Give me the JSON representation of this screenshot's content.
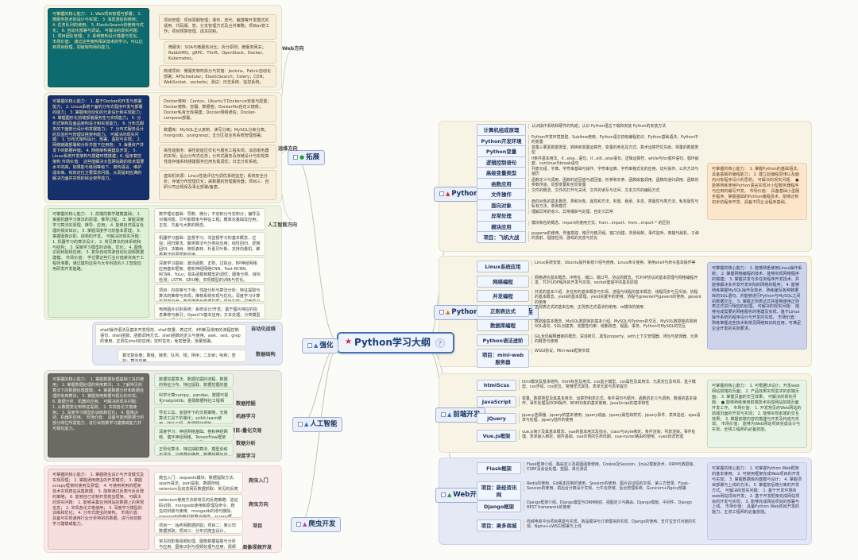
{
  "root": {
    "title": "Python学习大纲",
    "badge": "?"
  },
  "branches": {
    "tuozhan": {
      "label": "拓展"
    },
    "qianghua": {
      "label": "强化"
    },
    "ai": {
      "label": "人工智能"
    },
    "pachong": {
      "label": "爬虫开发"
    },
    "core": {
      "label": "Python核心编程"
    },
    "linux": {
      "label": "Python和Linux高级编程"
    },
    "front": {
      "label": "前端开发"
    },
    "web": {
      "label": "Web开发"
    }
  },
  "directions": {
    "web": "Web方向",
    "yunwei": "运维方向",
    "ai": "人工智能方向",
    "auto": "自动化运维",
    "datastruct": "数据结构",
    "spider": "爬虫方向",
    "project": "项目",
    "image": "图像视频开发",
    "entry": "爬虫入门",
    "ml": "机器学习",
    "quant": "项目:量化交易",
    "datacollect": "数据挖掘",
    "dataanalysis": "数据分析",
    "deeplearn": "深度学习"
  },
  "tuozhan": {
    "web": {
      "capability": "可掌握的核心能力：\n1. Web项目管理与部署；\n2. 微服务技术的设计与实现；\n3. 消息滞后的使用；\n4. 任务队列的使用；\n5. ElasticSearch的使用与优化；\n6. 自动化部署与调试。\n可解决的现实问题：\n1. 项目团队管理；\n2. 系统架构设计搭建与优化。\n市场价值：\n通过这些架构相关技术的学习，可以达到项目经理、初级架构师的能力。",
      "detail1": "项目管理：项目周期管理；瀑布、迭代、敏捷等开发模式的适用、代码版、管、分支管理方式及合并策略；项目as管工作；项目预算管理、成本控制。",
      "detail2": "微服务：SOA与微服务对比；拆分原则；微服务网关；RabbitMQ、gRPC、Thrift、OpenStack、Docker、Kubernetes。",
      "detail3": "商城项目：微服务架构拆分与实施：Jenkins、Fabric自动化部署；APScheduler；ElasticSearch；Celery；CDN；WebSocket、socketio；测试：日志系统、监控系统。"
    },
    "yunwei": {
      "capability": "可掌握的核心能力：\n1. 基于Docker的开发与部署能力；\n2. Linux系统下面的分布式程序开发与部署的能力；\n3. 掌握用自动化的元素设计和实现能力；\n4. 掌握图形化前端部署服务性与实现能力；\n5. 分布式架构及面品架构设计和实现能力；\n6. 分布式服务的下面部分设计和发展能力；\n7. 分布式服务设计的及监控与管理设搭架构能力。\n可解决的现实问题：\n1. 分布式架构设计、部署、监控与实现；\n2. 网络链路部署和分析并能下应用管；\n3. 海量资产并发下的数据存储；\n4. 网络架构搭建及开发；\n5. Linux系统开发架构与搭建环境搭建；6. 程序复控架构\n市场价值：\n这些能解决大型网站跨的技术需要水平的高，如果能与级别等级下、架构语言、维护成本高、有效定位主要需求问题，从而提到应满的解决方面并实现的综合架界能力。",
      "detail1": "Docker使用：Centos、Ubuntu下Docker-ce安装与配置；Docker镜像、容器、数据卷；Dockerfile自定义镜像；Docker私有仓库搭建；Docker网络通信；Docker-compose部署。",
      "detail2": "数据库：MySQL主从复制、读写分离；MySQL分库分表；mongodb、postgresql；五分区如业务系统管理部署。",
      "detail3": "高性能服务：高性能能区优化与服务工程实现；消息服务器的实现；后台分布式任务；分布式服务及存储设计与实现高性能存储系统搭建服务应用负载调优；日志分析系统。",
      "detail4": "虚拟机资源：Linux性能评估与调优系统监控；系统安全分析；存储分布管理优化；高数据的管理服务器；项目三：自研公司合规保及事业部署/备案。"
    },
    "ai_capability": {
      "capability": "可掌握的核心能力：\n1. 前端的数学建模基础；\n2. 掌握机器学习算法的原理、推导过程；\n3. 掌握深度学习算法的原理、推导、应用；\n4. 能够自然语言处理的相关知识；\n5. 掌握深度学习的基本原理；\n6. 掌握图像识别、视频的开发。\n可解决的现实问题：\n1. 机器学习的算法设计；\n2. 常见算法的体系统和与结构；\n3. 深度学习模型的训练、优化；\n4. 图像识别和视频应用；\n5. 复杂自动驾驶自动化视频数据建模。\n市场价值：\n学位要这些行业价值薪资高于工程师准据，通过建构这些与大专科技的人工智能应用研发开发能路。",
      "d1": "数学理论基础：导数、微分；不定积分与定积分；偏导及对偶问题；贝叶斯概率与特征工程；概率论基础及应用；正态、方差与大数的概念。",
      "d2": "机器学习基础：监督学习、非监督学习的基本概念、过拟；回归算法、聚类算法与分类的应用；线性回归、逻辑回归、决策树、随机森林、朴素贝叶斯、支持向量机、聚类算法的原理和应用。",
      "d3": "深度学习基础：激活函数、正则、过拟合、BP神经网络应用基本框架、卷积神经网络CNN、Fast-RCNN、RCNN、YoLo；损失函数和模型的调优；图像分类、目标检测；LSTM、GRU等；实现模型的训练与优化。",
      "d4": "项目：内容审与下滑；性能分析与算法分析；特征提取与算法的推荐与实现；推荐系统实现与优化；深度学习计算机视觉应用；数学建模与数据挖掘；项目实现：深度学习框架TensorFlow与Keras的应用与原理。",
      "d5": "电商图片识别系统：系统设计/开发；基于图片特征的信息推荐与索引；OpenCV基本应用；文本处理；分类模型构建；深度学习框架应用；RCNN、Fast-RCNN、YOLO；项目：拍立淘。"
    }
  },
  "qianghua": {
    "auto": "shell操作语法及基本开发规范、shell变量、表达式、if判断及常用的流程控制语句、shell函数、函数调用方式、shell函数的定义与使用、awk、sed、grep的使用、正则在shell的应用；定时任务；免密登录；批量部署。",
    "datastruct": "算法复杂度；数组、链表、队列、栈；排序；二叉树；哈希；查找；算法应用。"
  },
  "ai": {
    "capability": "可掌握的核心能力：\n1. 掌握数据处理基础工具的使用；\n2. 掌握数据处理的常用算法；\n3. 了解常见的算法下的数据处理建模；\n4. 掌握数据分析和数据处理的常用算法；\n5. 掌握常用数据可视化的实现；\n6. 数据分析、机器的应用。\n可解决的现实问题：\n1. 从数据变化到特征提取；\n2. 实现各论文格使用；\n3. 深度学习模型的训练和优化；\n4. 图像识别、机器的应用。\n市场价值：\n具备可能到数据分析部分岗位所需能力，进行目前数学习建模或能力并可视化能力。",
    "d1": "科学计算numpy、pandas、数据可视化matplotlib、金融数据特征工程相关。",
    "d2": "导论工具，金融学下的交易策略、交易算法工具下的量化；scikit-learn使用、特征工程、数据预处理等。",
    "d3": "深度学习：神经网络基础、卷积神经网络、循环神经网络、TensorFlow框架应用；深度学习算法模型。",
    "d4": "正则化算法、特征抽取算法、模型训练与评估、分类器与推荐、数据挖掘与应用。",
    "d5": "数据挖掘算法、数据挖掘的流程、数据的特征分布、特征提取、数据挖掘的基本实现。"
  },
  "pachong": {
    "capability": "可掌握的核心能力：\n1. 掌握爬虫设计与开发模式及实现原理；\n2. 掌握通用爬虫的开发模式；\n3. 掌握scrapy框架的使用及原理；\n4. 可使用常用的框架技术实现爬虫采集数据；\n5. 能够通过反爬与反反爬的策略；\n6. 能够自己定制开发爬虫框架。\n可解决的现实问题：\n1. 能够采集任何网站的数据上的常规信息；\n2. 实现各论文格使用；\n3. 深度学习模型的训练和优化；\n4. 分布式爬虫的架构。\n市场价值：\n具备可实现通用行业分析特别的数据，进行目前数学习建模或能力。",
    "d1": "爬虫入门：requests模块、数据提取方法、xpath语法、json提取、数据存储、selenium及动态网页数据抓取、常见的反爬策略。",
    "d2": "selenium使用方法和常见的反爬策略：验证码识别、mongodb使用和原理及命令、爬虫的封装与使用、mongodb的增与删除、mongodb的索引和聚合操作、scrapy框架、scrapy使用和原理、日志与分析。",
    "d3": "项目一：咕咚网数据抓取；项目二：某公司数据抓取；项目三：分布式爬虫设计。",
    "d4": "常见的影像视频处理、图像数据提取与分析与应用、图像识别与视频处理与应用、视频处理与常用视频处理、图像识别的基本概念与实现。"
  },
  "core": {
    "items": [
      {
        "label": "计算机组成原理",
        "text": "认识操作系统和硬件的构成；认识 Python语言下载和安装 Python的安装方法"
      },
      {
        "label": "Python开发环境",
        "text": "Python开发环境搭建、Sublime使用、Python语言初级编程初识、Python基础语法、Python中的变量"
      },
      {
        "label": "Python变量",
        "text": "变量三要素数据类型、转换和变量运算符、变量的命名及方式、算术运算符优先级、常量的数据类型"
      },
      {
        "label": "逻辑控制语句",
        "text": "if条件基本用法、if...else...语句、if...elif...else语句、逻辑运算符、while与for循环语句、循环嵌套、continue与break语句"
      },
      {
        "label": "高级变量类型",
        "text": "列表元组、字典、字符串基础与操作、字符串运算、字符串格式化的应用、切片操作、公共方法与遍历"
      },
      {
        "label": "函数应用",
        "text": "函数定义与调用、函数的返回值与返回值、形参和实参、函数嵌套调用、函数的递归调用、函数的参数传递、局部变量和全局变量"
      },
      {
        "label": "文件操作",
        "text": "文件的概念、文件的打开与关闭、文件的读写与访问、文本文件的编码方式"
      },
      {
        "label": "面向对象",
        "text": "面向对象的基本概念、类和对象、属性和方法、封装、继承、多态、类属性与类方法、私有属性与私有方法、单例模式"
      },
      {
        "label": "异常处理",
        "text": "理解异常的意义、异常捕获与处理、自定义异常"
      },
      {
        "label": "模块应用",
        "text": "模块和包的概念、import的使用方式、from...import、from...import * 的区别"
      },
      {
        "label": "项目：飞机大战",
        "text": "pygame的使用、界面搭建、精灵与精灵组、窗口创建、背景绘制、事件监听、英雄与敌机、子弹的发射、碰撞检测、游戏的完善与优化"
      }
    ],
    "capability": "可掌握的核心能力：\n1. 掌握Python的基础语法，具备基础的编程能力；\n2. 建立起编程思维以及面向对象程序设计的思想。\n可解决的现实问题：\n● 能够熟练使用Python语言实现对小型服务器程序与应用的编写开发。\n市场价值：\n具备基础小型服务程序，掌握基础的Python编程技术，能够达到初步的程序开发、具备不同企业程序基础。"
  },
  "linux": {
    "items": [
      {
        "label": "Linux系统应用",
        "text": "Linux系统安装、Ubuntu操作系统介绍与使用、Linux命令使用、常用shell与命令基本操作等"
      },
      {
        "label": "网络编程",
        "text": "网络通信基本概念、IP地址、端口、端口号、协议的概念、TCP/IP协议的基本原理与网络编程开发、TCP/UDP程序的开发与实现、socket套接字的基本原理"
      },
      {
        "label": "并发编程",
        "text": "并发的基本介绍、多任务的基本概念与实现、进程与线程的基本概念、线程同步与互斥锁、协程的基本概念、yield的基本原理、yield关键字的使用、协程与greenlet与gevent的使用、gevent的使用"
      },
      {
        "label": "正则表达式",
        "text": "正则表达式的基本应用、正则表达式语法的使用、re模块的使用"
      },
      {
        "label": "数据库编程",
        "text": "数据库基本概念、MySQL数据库的基本介绍、MySQL与Python的交互、MySQL数据库的常用SQL语句、SQL创建表、完整性约束、增删改查、视图、事务、Python与MySQL的交互"
      },
      {
        "label": "Python语法进阶",
        "text": "GIL全局解释器锁的概念、深浅拷贝、属性property、with上下文管理器、闭包与装饰器、元类的概念与使用"
      },
      {
        "label": "项目：mini-web服务器",
        "text": "WSGI协议、Mini-web框架实现"
      }
    ],
    "capability": "可掌握的核心能力：\n1. 能够熟悉使用Linux操作系统；\n2. 掌握网络编程的技术、能够实现网络程序的搭建；\n3. 掌握并发与多任务程序开发技术、并能够解决多并发开发实际的网络的程序；\n4. 能够熟练掌握MySQL操作及技术、熟练编写各种数据库的SQL语句、并能够进行Python与MySQL之间的数据交互；\n5. 掌握正则表达式并能够使用正则表达式进行相应的处理。\n可解决的现实问题：\n能够完成需要的网络服务的搭建及实现、基于Linux操作系统的程序设计与开发的实现。\n市场价值：\n熟练掌握这些技术和常见网络知识的应用，可满足企业开发的实际要求。"
  },
  "front": {
    "items": [
      {
        "label": "htmlScss",
        "text": "html模块及基本结构、html标签及用法、css盒子模型、css属性及其用法、元素定位及布局、盒子模型、css浮动、css定位、常用样式属性、表单元素与表单提交"
      },
      {
        "label": "JavaScript",
        "text": "变量、数据类型及其基本用法、运算符和表达式、条件语句与循环、函数的定义与调用、数组的基本操作、事件处理及DOM操作、BOM对象的基本使用、JavaScript的基本特性"
      },
      {
        "label": "jQuery",
        "text": "jquery选择器、jquery的基本使用、jquery动画、jquery属性和样式、jquery事件、表单验证、ajax请求与处理、jquery插件的使用"
      },
      {
        "label": "Vue.js框架",
        "text": "vue.js简介及其基本概念、vue的基本用法及指令、class与style绑定、条件渲染、列表渲染、事件处理、表单输入绑定、组件基础、vue实例的生命周期、vue-router路由的使用、vuex状态管理"
      }
    ],
    "capability": "可掌握的核心能力：\n1. 可根据UI设计，开发web网站前端的页面；\n2. 产品效果实现需求的前端页面；\n3. 掌握页面的交互效果。\n可解决的现实问题：\n● 能够熟练使用前端技术完成网站前端页面开发工作。\n市场价值：\n1. 开发常见的Web网站的前端页面的开发与实现；\n2. 能够实现前端的交互效果；\n3. 掌握前端内容的搭建与开发及构成与实现。\n市场价值：\n能够为Web网站项目完成设计与实现，全栈工程师的必备技能。"
  },
  "web": {
    "items": [
      {
        "label": "Flask框架",
        "text": "Flask框架介绍、路由定义及视图函数使用、Cookie及Session、Jinja2模板技术、ORM与数据库、CSRF及会话处理、蓝图、单元测试"
      },
      {
        "label": "项目：新经资讯网",
        "text": "Redis的使用、Git版本控制的使用、Session的使用、图片验证码的实现、第三方登录、Flask-Session的使用、前后台分离设计实现、七牛云存储、后台管理系统、Gunicorn+Nginx部署"
      },
      {
        "label": "Django框架",
        "text": "Django框架介绍、Django模型与ORM映射、视图定义与路由、Django模板、中间件、Django REST framework的使用"
      },
      {
        "label": "项目：果多商城",
        "text": "商城电商平台项目搭建与实现、商品模块与订单模块的实现、Django的使用、支付宝支付对接的实现、Nginx+uWSGI部署与上线"
      }
    ],
    "capability": "可掌握的核心能力：\n1. 可掌握Python Web框架的基本使用；\n2. 可使用框架完成Web项目的开发与实现；\n3. 掌握数据库的建模与设计；\n4. 掌握项目部署与上线的方法；\n5. 掌握前后端分离的开发方式。\n可解决的现实问题：\n1. 基于开发环境的web网站项目开发；\n2. 基于开发框架完成网站项目的开发与实现；\n3. 能够完成网站项目的部署与上线。\n市场价值：\n具备Python Web项目开发的能力，主流工程师的必备技能。"
  }
}
